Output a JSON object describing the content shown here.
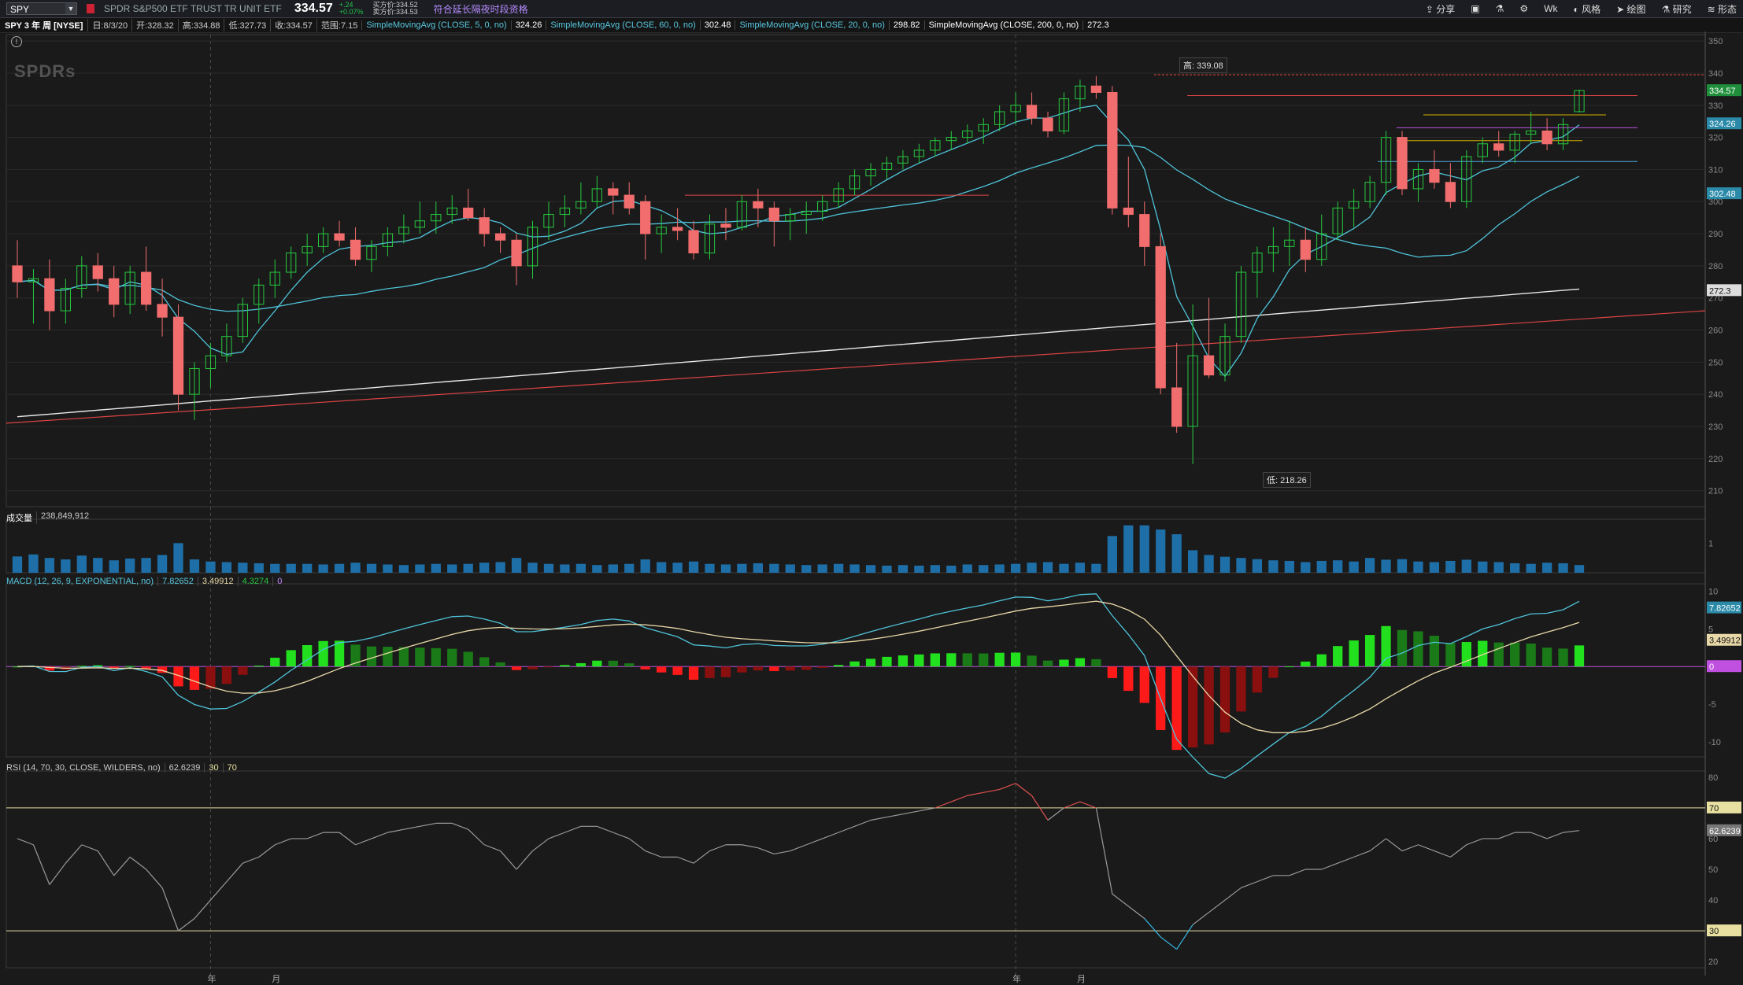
{
  "toolbar": {
    "symbol": "SPY",
    "description": "SPDR S&P500 ETF TRUST TR UNIT ETF",
    "last": "334.57",
    "change": "+.24",
    "change_pct": "+0.07%",
    "bid": "买方价:334.52",
    "ask": "卖方价:334.53",
    "extended": "符合延长隔夜时段资格",
    "share": "分享",
    "timeframe": "Wk",
    "style": "风格",
    "draw": "绘图",
    "study": "研究",
    "pattern": "形态"
  },
  "info": {
    "title": "SPY 3 年 周 [NYSE]",
    "date": "日:8/3/20",
    "open": "开:328.32",
    "high": "高:334.88",
    "low": "低:327.73",
    "close": "收:334.57",
    "range": "范围:7.15",
    "sma5_label": "SimpleMovingAvg (CLOSE, 5, 0, no)",
    "sma5_val": "324.26",
    "sma60_label": "SimpleMovingAvg (CLOSE, 60, 0, no)",
    "sma60_val": "302.48",
    "sma20_label": "SimpleMovingAvg (CLOSE, 20, 0, no)",
    "sma20_val": "298.82",
    "sma200_label": "SimpleMovingAvg (CLOSE, 200, 0, no)",
    "sma200_val": "272.3"
  },
  "watermark": "SPDRs",
  "price_axis": [
    "350",
    "340",
    "330",
    "320",
    "310",
    "300",
    "290",
    "280",
    "270",
    "260",
    "250",
    "240",
    "230",
    "220",
    "210"
  ],
  "price_badges": {
    "last": "334.57",
    "sma5": "324.26",
    "sma60": "302.48",
    "sma200": "272.3"
  },
  "hi_label": "高: 339.08",
  "lo_label": "低: 218.26",
  "volume": {
    "label": "成交量",
    "value": "238,849,912",
    "axis": [
      "1"
    ]
  },
  "macd": {
    "label": "MACD (12, 26, 9, EXPONENTIAL, no)",
    "v1": "7.82652",
    "v2": "3.49912",
    "v3": "4.3274",
    "v4": "0",
    "axis": [
      "10",
      "5",
      "0",
      "-5",
      "-10"
    ],
    "badge1": "7.82652",
    "badge2": "3.49912",
    "badge3": "0"
  },
  "rsi": {
    "label": "RSI (14, 70, 30, CLOSE, WILDERS, no)",
    "value": "62.6239",
    "ob": "30",
    "os": "70",
    "axis": [
      "80",
      "70",
      "60",
      "50",
      "40",
      "30",
      "20"
    ],
    "badge_ob": "70",
    "badge_val": "62.6239",
    "badge_os": "30"
  },
  "time_axis": [
    "年",
    "月",
    "年",
    "月"
  ],
  "colors": {
    "up": "#27c93f",
    "down": "#f26d6d",
    "sma": "#4fc3d9",
    "bg": "#1a1a1a",
    "grid": "#2a2a2a"
  },
  "chart_data": {
    "type": "candlestick",
    "ylim": [
      205,
      352
    ],
    "ohlc": [
      [
        280,
        288,
        270,
        275
      ],
      [
        275,
        279,
        262,
        276
      ],
      [
        276,
        282,
        260,
        266
      ],
      [
        266,
        276,
        262,
        273
      ],
      [
        273,
        283,
        270,
        280
      ],
      [
        280,
        284,
        272,
        276
      ],
      [
        276,
        280,
        264,
        268
      ],
      [
        268,
        280,
        265,
        278
      ],
      [
        278,
        286,
        266,
        268
      ],
      [
        268,
        276,
        258,
        264
      ],
      [
        264,
        268,
        235,
        240
      ],
      [
        240,
        250,
        232,
        248
      ],
      [
        248,
        256,
        242,
        252
      ],
      [
        252,
        262,
        250,
        258
      ],
      [
        258,
        270,
        256,
        268
      ],
      [
        268,
        276,
        262,
        274
      ],
      [
        274,
        282,
        270,
        278
      ],
      [
        278,
        286,
        276,
        284
      ],
      [
        284,
        290,
        280,
        286
      ],
      [
        286,
        292,
        284,
        290
      ],
      [
        290,
        294,
        286,
        288
      ],
      [
        288,
        292,
        280,
        282
      ],
      [
        282,
        288,
        278,
        286
      ],
      [
        286,
        292,
        283,
        290
      ],
      [
        290,
        296,
        287,
        292
      ],
      [
        292,
        300,
        290,
        294
      ],
      [
        294,
        300,
        290,
        296
      ],
      [
        296,
        302,
        293,
        298
      ],
      [
        298,
        304,
        294,
        295
      ],
      [
        295,
        298,
        286,
        290
      ],
      [
        290,
        292,
        284,
        288
      ],
      [
        288,
        290,
        274,
        280
      ],
      [
        280,
        294,
        276,
        292
      ],
      [
        292,
        300,
        288,
        296
      ],
      [
        296,
        302,
        292,
        298
      ],
      [
        298,
        306,
        296,
        300
      ],
      [
        300,
        308,
        298,
        304
      ],
      [
        304,
        306,
        296,
        302
      ],
      [
        302,
        306,
        296,
        298
      ],
      [
        300,
        302,
        282,
        290
      ],
      [
        290,
        296,
        284,
        292
      ],
      [
        292,
        298,
        288,
        291
      ],
      [
        291,
        294,
        282,
        284
      ],
      [
        284,
        296,
        282,
        293
      ],
      [
        293,
        298,
        288,
        292
      ],
      [
        292,
        302,
        291,
        300
      ],
      [
        300,
        304,
        292,
        298
      ],
      [
        298,
        300,
        286,
        294
      ],
      [
        294,
        298,
        288,
        296
      ],
      [
        296,
        300,
        290,
        297
      ],
      [
        297,
        302,
        294,
        300
      ],
      [
        300,
        306,
        298,
        304
      ],
      [
        304,
        310,
        302,
        308
      ],
      [
        308,
        312,
        305,
        310
      ],
      [
        310,
        314,
        307,
        312
      ],
      [
        312,
        316,
        310,
        314
      ],
      [
        314,
        318,
        312,
        316
      ],
      [
        316,
        320,
        314,
        319
      ],
      [
        319,
        322,
        316,
        320
      ],
      [
        320,
        324,
        318,
        322
      ],
      [
        322,
        326,
        318,
        324
      ],
      [
        324,
        330,
        322,
        328
      ],
      [
        328,
        334,
        324,
        330
      ],
      [
        330,
        334,
        324,
        326
      ],
      [
        326,
        328,
        320,
        322
      ],
      [
        322,
        334,
        321,
        332
      ],
      [
        332,
        338,
        328,
        336
      ],
      [
        336,
        339.08,
        332,
        334
      ],
      [
        334,
        336,
        296,
        298
      ],
      [
        298,
        314,
        292,
        296
      ],
      [
        296,
        300,
        280,
        286
      ],
      [
        286,
        290,
        240,
        242
      ],
      [
        242,
        256,
        228,
        230
      ],
      [
        230,
        268,
        218.26,
        252
      ],
      [
        252,
        270,
        245,
        246
      ],
      [
        246,
        262,
        244,
        258
      ],
      [
        258,
        280,
        256,
        278
      ],
      [
        278,
        286,
        270,
        284
      ],
      [
        284,
        292,
        278,
        286
      ],
      [
        286,
        294,
        280,
        288
      ],
      [
        288,
        292,
        278,
        282
      ],
      [
        282,
        296,
        280,
        290
      ],
      [
        290,
        300,
        288,
        298
      ],
      [
        298,
        304,
        292,
        300
      ],
      [
        300,
        308,
        298,
        306
      ],
      [
        306,
        322,
        302,
        320
      ],
      [
        320,
        322,
        302,
        304
      ],
      [
        304,
        312,
        300,
        310
      ],
      [
        310,
        316,
        304,
        306
      ],
      [
        306,
        312,
        298,
        300
      ],
      [
        300,
        316,
        298,
        314
      ],
      [
        314,
        320,
        312,
        318
      ],
      [
        318,
        322,
        314,
        316
      ],
      [
        316,
        322,
        312,
        321
      ],
      [
        321,
        328,
        318,
        322
      ],
      [
        322,
        326,
        316,
        318
      ],
      [
        318,
        326,
        316,
        324
      ],
      [
        328,
        334.88,
        327.73,
        334.57
      ]
    ],
    "volume": [
      0.55,
      0.62,
      0.5,
      0.45,
      0.58,
      0.5,
      0.42,
      0.48,
      0.5,
      0.6,
      1.0,
      0.45,
      0.38,
      0.36,
      0.34,
      0.32,
      0.3,
      0.3,
      0.3,
      0.28,
      0.3,
      0.34,
      0.3,
      0.28,
      0.26,
      0.28,
      0.3,
      0.28,
      0.3,
      0.34,
      0.36,
      0.5,
      0.34,
      0.3,
      0.28,
      0.3,
      0.26,
      0.28,
      0.3,
      0.45,
      0.36,
      0.34,
      0.38,
      0.3,
      0.28,
      0.3,
      0.32,
      0.3,
      0.28,
      0.26,
      0.28,
      0.3,
      0.28,
      0.26,
      0.24,
      0.26,
      0.24,
      0.26,
      0.24,
      0.28,
      0.26,
      0.28,
      0.3,
      0.34,
      0.36,
      0.3,
      0.34,
      0.3,
      1.24,
      1.6,
      1.6,
      1.46,
      1.3,
      0.76,
      0.6,
      0.54,
      0.5,
      0.46,
      0.42,
      0.4,
      0.36,
      0.4,
      0.42,
      0.38,
      0.5,
      0.44,
      0.46,
      0.38,
      0.36,
      0.4,
      0.44,
      0.38,
      0.36,
      0.32,
      0.3,
      0.34,
      0.32,
      0.26
    ],
    "rsi": [
      60,
      58,
      45,
      52,
      58,
      56,
      48,
      54,
      50,
      44,
      30,
      34,
      40,
      46,
      52,
      54,
      58,
      60,
      60,
      62,
      62,
      58,
      60,
      62,
      63,
      64,
      65,
      65,
      63,
      58,
      56,
      50,
      56,
      60,
      62,
      64,
      64,
      62,
      60,
      56,
      54,
      54,
      52,
      56,
      58,
      58,
      57,
      55,
      56,
      58,
      60,
      62,
      64,
      66,
      67,
      68,
      69,
      70,
      72,
      74,
      75,
      76,
      78,
      74,
      66,
      70,
      72,
      70,
      42,
      38,
      34,
      28,
      24,
      32,
      36,
      40,
      44,
      46,
      48,
      48,
      50,
      50,
      52,
      54,
      56,
      60,
      56,
      58,
      56,
      54,
      58,
      60,
      60,
      62,
      62,
      60,
      62,
      62.62
    ]
  }
}
